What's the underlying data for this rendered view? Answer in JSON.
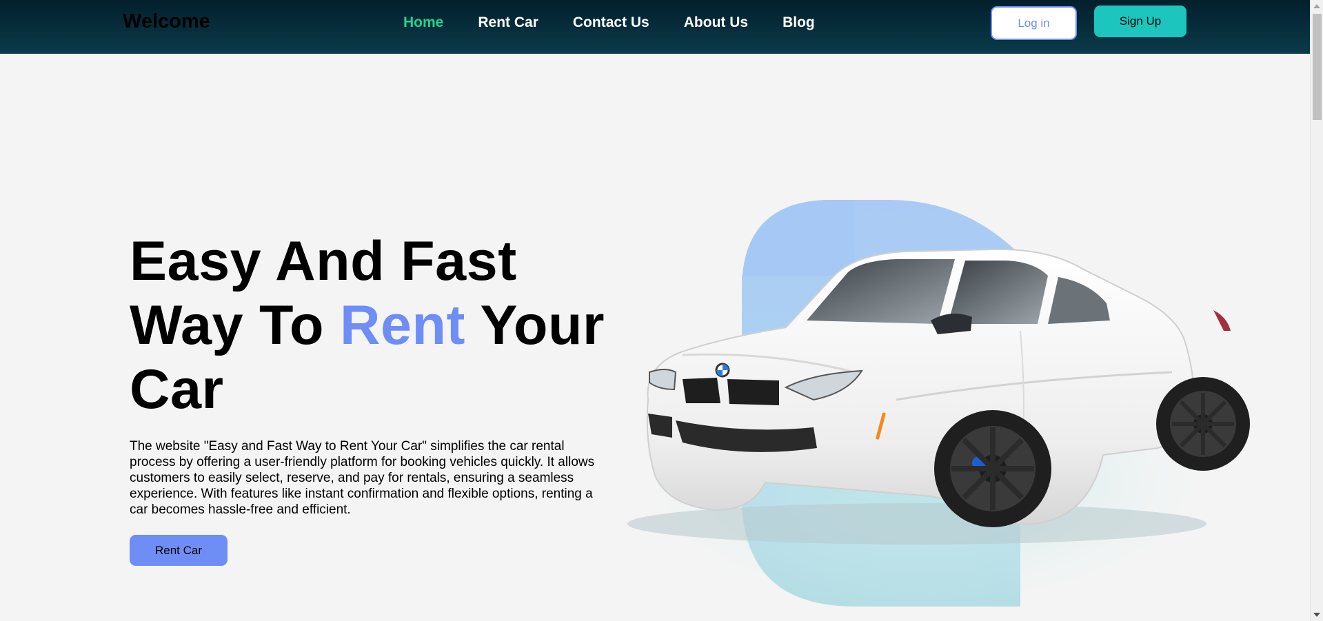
{
  "navbar": {
    "brand": "Welcome",
    "links": [
      {
        "label": "Home",
        "active": true
      },
      {
        "label": "Rent Car",
        "active": false
      },
      {
        "label": "Contact Us",
        "active": false
      },
      {
        "label": "About Us",
        "active": false
      },
      {
        "label": "Blog",
        "active": false
      }
    ],
    "login_label": "Log in",
    "signup_label": "Sign Up"
  },
  "hero": {
    "title_line1": "Easy And Fast",
    "title_line2_pre": "Way To ",
    "title_line2_accent": "Rent",
    "title_line2_post": " Your",
    "title_line3": "Car",
    "description": "The website \"Easy and Fast Way to Rent Your Car\" simplifies the car rental process by offering a user-friendly platform for booking vehicles quickly. It allows customers to easily select, reserve, and pay for rentals, ensuring a seamless experience. With features like instant confirmation and flexible options, renting a car becomes hassle-free and efficient.",
    "cta_label": "Rent Car"
  },
  "colors": {
    "accent": "#6e8ef5",
    "active_nav": "#1fd68a",
    "signup_bg": "#1cc6bf",
    "navbar_dark": "#031f2c"
  },
  "icons": {
    "car": "car-illustration"
  }
}
